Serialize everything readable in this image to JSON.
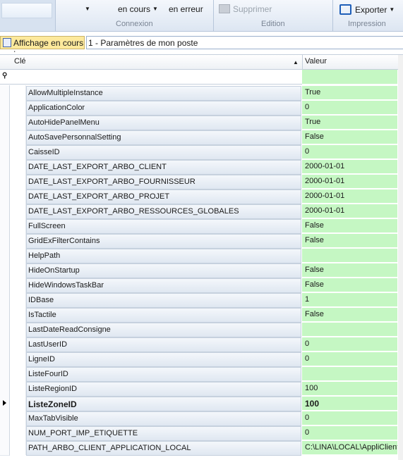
{
  "ribbon": {
    "connexion": {
      "btn_en_cours": "en cours",
      "btn_en_erreur": "en erreur",
      "group_label": "Connexion"
    },
    "edition": {
      "btn_supprimer": "Supprimer",
      "group_label": "Edition"
    },
    "impression": {
      "btn_exporter": "Exporter",
      "group_label": "Impression"
    }
  },
  "view": {
    "label": "Affichage en cours :",
    "value": "1 - Paramètres de mon poste"
  },
  "grid": {
    "col_key": "Clé",
    "col_value": "Valeur",
    "filter_icon": "pin-icon",
    "selected_index": 21,
    "rows": [
      {
        "key": "AllowMultipleInstance",
        "value": "True"
      },
      {
        "key": "ApplicationColor",
        "value": "0"
      },
      {
        "key": "AutoHidePanelMenu",
        "value": "True"
      },
      {
        "key": "AutoSavePersonnalSetting",
        "value": "False"
      },
      {
        "key": "CaisseID",
        "value": "0"
      },
      {
        "key": "DATE_LAST_EXPORT_ARBO_CLIENT",
        "value": "2000-01-01"
      },
      {
        "key": "DATE_LAST_EXPORT_ARBO_FOURNISSEUR",
        "value": "2000-01-01"
      },
      {
        "key": "DATE_LAST_EXPORT_ARBO_PROJET",
        "value": "2000-01-01"
      },
      {
        "key": "DATE_LAST_EXPORT_ARBO_RESSOURCES_GLOBALES",
        "value": "2000-01-01"
      },
      {
        "key": "FullScreen",
        "value": "False"
      },
      {
        "key": "GridExFilterContains",
        "value": "False"
      },
      {
        "key": "HelpPath",
        "value": ""
      },
      {
        "key": "HideOnStartup",
        "value": "False"
      },
      {
        "key": "HideWindowsTaskBar",
        "value": "False"
      },
      {
        "key": "IDBase",
        "value": "1"
      },
      {
        "key": "IsTactile",
        "value": "False"
      },
      {
        "key": "LastDateReadConsigne",
        "value": ""
      },
      {
        "key": "LastUserID",
        "value": "0"
      },
      {
        "key": "LigneID",
        "value": "0"
      },
      {
        "key": "ListeFourID",
        "value": ""
      },
      {
        "key": "ListeRegionID",
        "value": "100"
      },
      {
        "key": "ListeZoneID",
        "value": "100"
      },
      {
        "key": "MaxTabVisible",
        "value": "0"
      },
      {
        "key": "NUM_PORT_IMP_ETIQUETTE",
        "value": "0"
      },
      {
        "key": "PATH_ARBO_CLIENT_APPLICATION_LOCAL",
        "value": "C:\\LINA\\LOCAL\\AppliClient"
      }
    ]
  },
  "colors": {
    "value_bg": "#c5f7c3",
    "view_label_bg": "#fde99c"
  }
}
